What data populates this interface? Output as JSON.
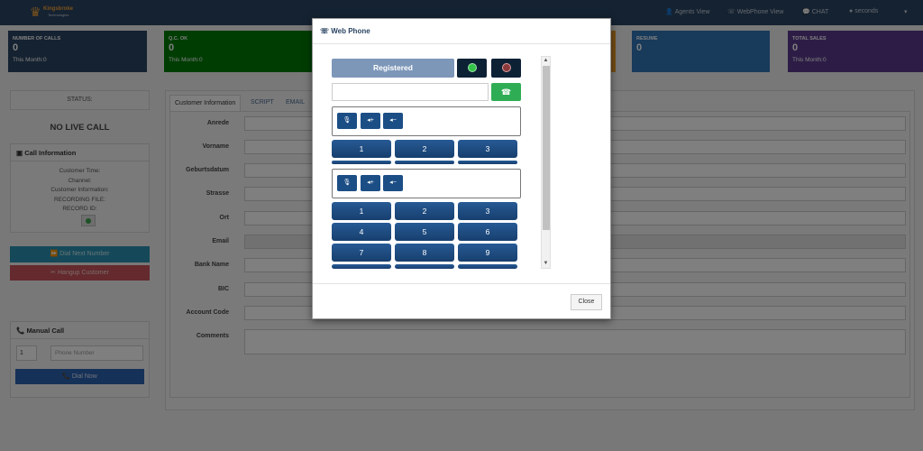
{
  "app": {
    "brand": "Kingsbroke",
    "brand_sub": "Technologies"
  },
  "nav": {
    "agents_view": "Agents View",
    "webphone_view": "WebPhone View",
    "chat": "CHAT",
    "seconds": "seconds",
    "user_menu": "▾"
  },
  "cards": [
    {
      "title": "NUMBER OF CALLS",
      "value": "0",
      "sub": "This Month:0",
      "color": "#2b4563"
    },
    {
      "title": "Q.C. OK",
      "value": "0",
      "sub": "This Month:0",
      "color": "#007a07"
    },
    {
      "title": "RESUME",
      "value": "0",
      "sub": "",
      "color": "#3175b7"
    },
    {
      "title": "TOTAL SALES",
      "value": "0",
      "sub": "This Month:0",
      "color": "#5a3a8c"
    }
  ],
  "left": {
    "status_label": "STATUS:",
    "no_live_call": "NO LIVE CALL",
    "call_info_title": "Call Information",
    "call_info_lines": [
      "Customer Time:",
      "Channel:",
      "Customer Information:",
      "RECORDING FILE:",
      "RECORD ID:"
    ],
    "dial_next": "Dial Next Number",
    "hangup": "Hangup Customer",
    "manual_call_title": "Manual Call",
    "manual_prefix": "1",
    "phone_placeholder": "Phone Number",
    "dial_now": "Dial Now"
  },
  "tabs": [
    "Customer Information",
    "SCRIPT",
    "EMAIL"
  ],
  "form": {
    "labels": [
      "Anrede",
      "Vorname",
      "Geburtsdatum",
      "Strasse",
      "Ort",
      "Email",
      "Bank Name",
      "BIC",
      "Account Code",
      "Comments"
    ]
  },
  "modal": {
    "title": "Web Phone",
    "registered": "Registered",
    "call_icon": "☎",
    "keypad1": [
      "1",
      "2",
      "3"
    ],
    "keypad2": [
      "1",
      "2",
      "3",
      "4",
      "5",
      "6",
      "7",
      "8",
      "9"
    ],
    "close": "Close",
    "colors": {
      "led_green": "#35c44a",
      "led_red": "#d94a4a"
    }
  },
  "icons": {
    "mic": "mic-icon",
    "vol_up": "volume-up-icon",
    "vol_down": "volume-down-icon"
  }
}
